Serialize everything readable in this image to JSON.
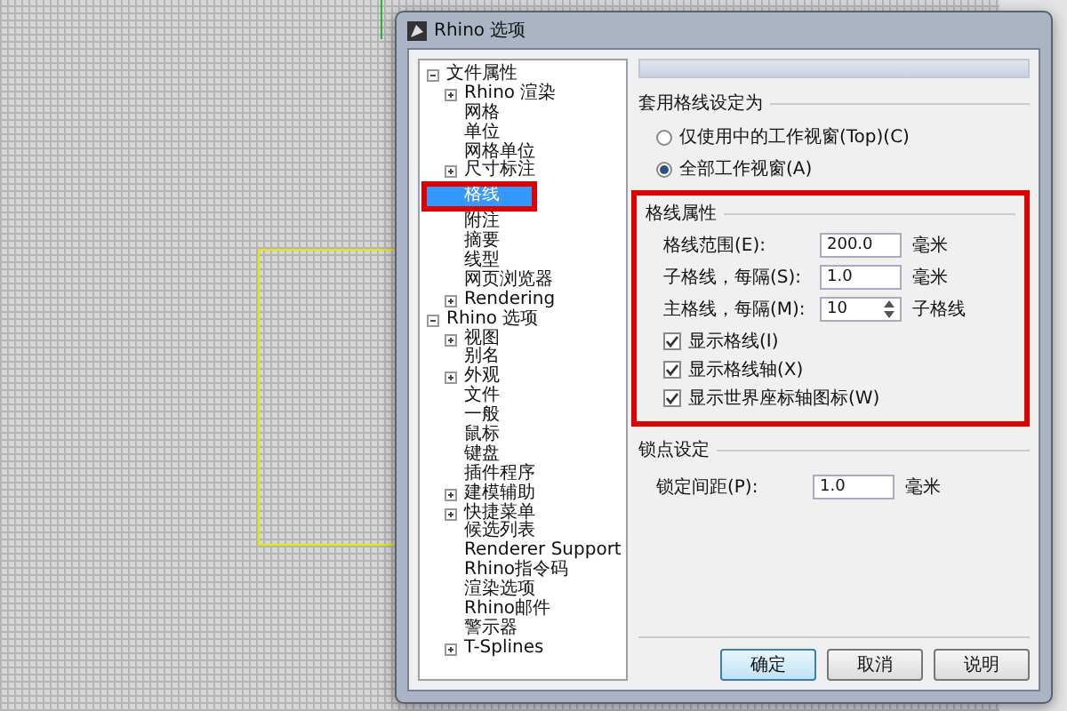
{
  "window": {
    "title": "Rhino 选项"
  },
  "tree": [
    {
      "label": "文件属性",
      "expanded": true,
      "selected": false,
      "children": [
        {
          "label": "Rhino 渲染",
          "expanded": false,
          "selected": false
        },
        {
          "label": "网格",
          "selected": false
        },
        {
          "label": "单位",
          "selected": false
        },
        {
          "label": "网格单位",
          "selected": false
        },
        {
          "label": "尺寸标注",
          "expanded": false,
          "selected": false
        },
        {
          "label": "格线",
          "selected": true,
          "highlighted": true
        },
        {
          "label": "附注",
          "selected": false
        },
        {
          "label": "摘要",
          "selected": false
        },
        {
          "label": "线型",
          "selected": false
        },
        {
          "label": "网页浏览器",
          "selected": false
        },
        {
          "label": "Rendering",
          "expanded": false,
          "selected": false
        }
      ]
    },
    {
      "label": "Rhino 选项",
      "expanded": true,
      "selected": false,
      "children": [
        {
          "label": "视图",
          "expanded": false,
          "selected": false
        },
        {
          "label": "别名",
          "selected": false
        },
        {
          "label": "外观",
          "expanded": false,
          "selected": false
        },
        {
          "label": "文件",
          "selected": false
        },
        {
          "label": "一般",
          "selected": false
        },
        {
          "label": "鼠标",
          "selected": false
        },
        {
          "label": "键盘",
          "selected": false
        },
        {
          "label": "插件程序",
          "selected": false
        },
        {
          "label": "建模辅助",
          "expanded": false,
          "selected": false
        },
        {
          "label": "快捷菜单",
          "expanded": false,
          "selected": false
        },
        {
          "label": "候选列表",
          "selected": false
        },
        {
          "label": "Renderer Support",
          "selected": false
        },
        {
          "label": "Rhino指令码",
          "selected": false
        },
        {
          "label": "渲染选项",
          "selected": false
        },
        {
          "label": "Rhino邮件",
          "selected": false
        },
        {
          "label": "警示器",
          "selected": false
        },
        {
          "label": "T-Splines",
          "expanded": false,
          "selected": false
        }
      ]
    }
  ],
  "apply_grid": {
    "title": "套用格线设定为",
    "options": [
      {
        "label": "仅使用中的工作视窗(Top)(C)",
        "selected": false
      },
      {
        "label": "全部工作视窗(A)",
        "selected": true
      }
    ]
  },
  "grid_properties": {
    "title": "格线属性",
    "highlighted": true,
    "fields": [
      {
        "kind": "text",
        "label": "格线范围(E):",
        "value": "200.0",
        "unit": "毫米"
      },
      {
        "kind": "text",
        "label": "子格线，每隔(S):",
        "value": "1.0",
        "unit": "毫米"
      },
      {
        "kind": "spinner",
        "label": "主格线，每隔(M):",
        "value": "10",
        "unit": "子格线"
      }
    ],
    "checkboxes": [
      {
        "label": "显示格线(I)",
        "checked": true
      },
      {
        "label": "显示格线轴(X)",
        "checked": true
      },
      {
        "label": "显示世界座标轴图标(W)",
        "checked": true
      }
    ]
  },
  "snap": {
    "title": "锁点设定",
    "fields": [
      {
        "kind": "text",
        "label": "锁定间距(P):",
        "value": "1.0",
        "unit": "毫米"
      }
    ]
  },
  "buttons": [
    {
      "label": "确定",
      "default": true
    },
    {
      "label": "取消",
      "default": false
    },
    {
      "label": "说明",
      "default": false
    }
  ]
}
